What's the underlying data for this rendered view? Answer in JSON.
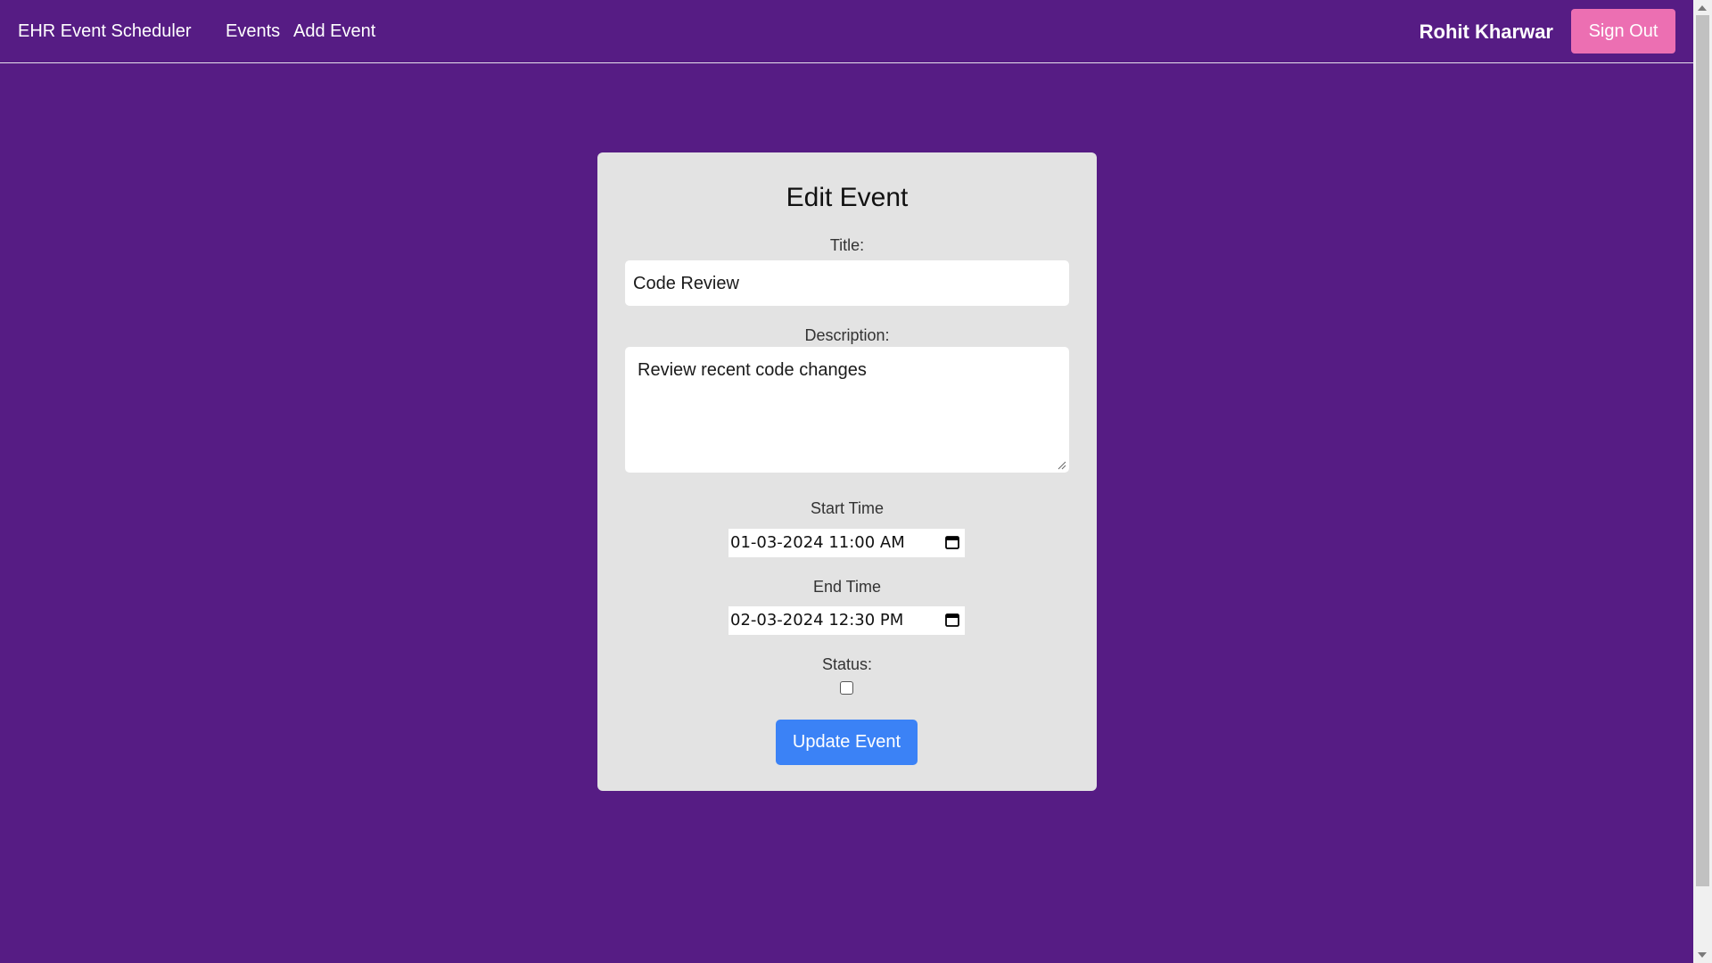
{
  "navbar": {
    "brand": "EHR Event Scheduler",
    "links": [
      "Events",
      "Add Event"
    ],
    "user_name": "Rohit Kharwar",
    "sign_out_label": "Sign Out"
  },
  "form": {
    "heading": "Edit Event",
    "title_label": "Title:",
    "title_value": "Code Review",
    "description_label": "Description:",
    "description_value": "Review recent code changes",
    "start_label": "Start Time",
    "start_value": "01-03-2024 11:00 AM",
    "end_label": "End Time",
    "end_value": "02-03-2024 12:30 PM",
    "status_label": "Status:",
    "status_checked": false,
    "submit_label": "Update Event"
  },
  "icons": {
    "calendar": "calendar-icon",
    "resize": "resize-grip-icon"
  },
  "colors": {
    "background": "#561c84",
    "sign_out": "#ec6fb2",
    "submit": "#3b82f6",
    "card": "#e3e3e3"
  }
}
